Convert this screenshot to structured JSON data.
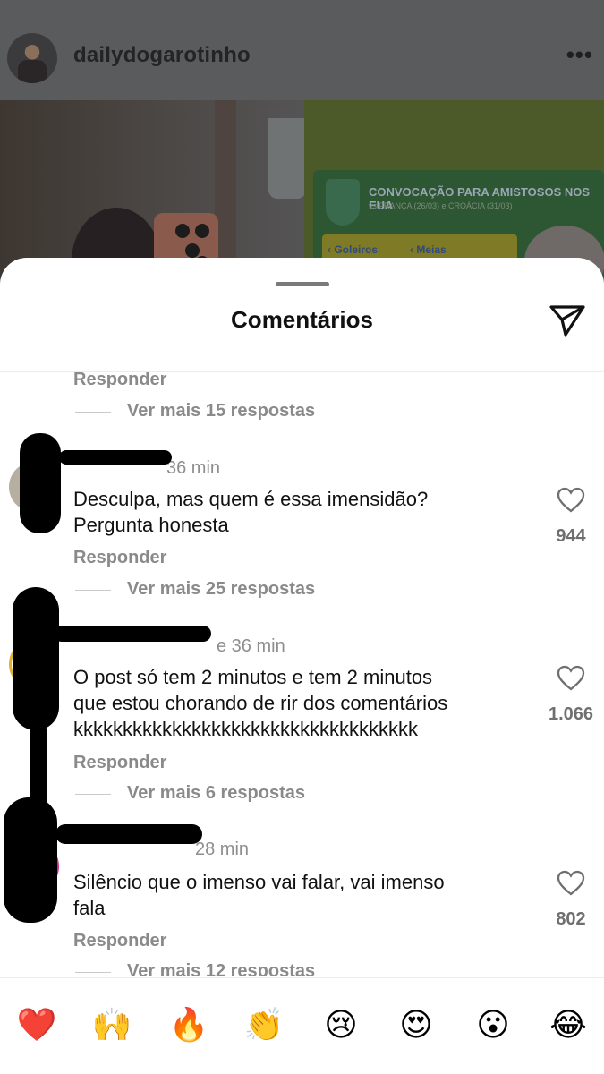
{
  "post": {
    "username": "dailydogarotinho",
    "more_icon": "more-horizontal-icon",
    "tv_title": "CONVOCAÇÃO PARA AMISTOSOS NOS EUA",
    "tv_subtitle": "vs FRANÇA (26/03) e CROÁCIA (31/03)",
    "tv_label_goleiros": "‹ Goleiros",
    "tv_label_meias": "‹ Meias"
  },
  "sheet": {
    "title": "Comentários",
    "send_icon": "paper-plane-icon"
  },
  "comments": [
    {
      "reply_label": "Responder",
      "more_replies": "Ver mais 15 respostas"
    },
    {
      "time": "36 min",
      "text_line1": "Desculpa, mas quem é essa imensidão?",
      "text_line2": "Pergunta honesta",
      "likes": "944",
      "reply_label": "Responder",
      "more_replies": "Ver mais 25 respostas"
    },
    {
      "time_partial": "e 36 min",
      "text_line1": "O post só tem 2 minutos e tem 2 minutos",
      "text_line2": "que estou chorando de rir dos comentários",
      "text_line3": "kkkkkkkkkkkkkkkkkkkkkkkkkkkkkkkkkkk",
      "likes": "1.066",
      "reply_label": "Responder",
      "more_replies": "Ver mais 6 respostas"
    },
    {
      "time": "28 min",
      "text_line1": "Silêncio que o imenso vai falar, vai imenso",
      "text_line2": "fala",
      "likes": "802",
      "reply_label": "Responder",
      "more_replies": "Ver mais 12 respostas"
    }
  ],
  "reactions": [
    "❤️",
    "🙌",
    "🔥",
    "👏",
    "😢",
    "😍",
    "😮",
    "😂"
  ],
  "colors": {
    "overlay": "#5e5f61",
    "secondary_text": "#8a8a8a",
    "primary_text": "#111111"
  }
}
